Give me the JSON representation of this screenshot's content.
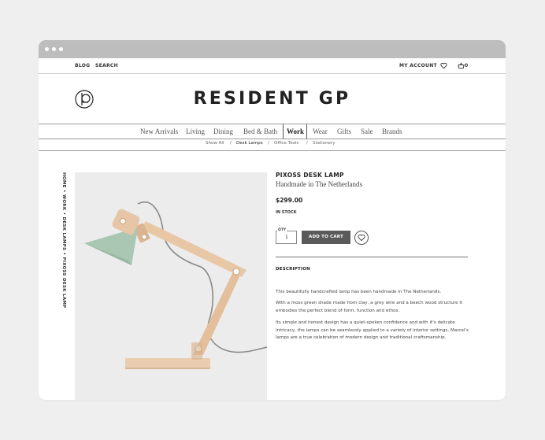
{
  "topbar": {
    "blog": "BLOG",
    "search": "SEARCH",
    "account": "MY ACCOUNT",
    "cart_count": "0"
  },
  "brand": {
    "name": "RESIDENT GP"
  },
  "nav": {
    "items": [
      "New Arrivals",
      "Living",
      "Dining",
      "Bed & Bath",
      "Work",
      "Wear",
      "Gifts",
      "Sale",
      "Brands"
    ],
    "active": "Work"
  },
  "subnav": {
    "items": [
      "Show All",
      "Desk Lamps",
      "Office Tools",
      "Stationery"
    ],
    "separators": [
      "/",
      "/",
      "/"
    ],
    "active": "Desk Lamps"
  },
  "breadcrumb": "HOME • WORK • DESK LAMPS • PIXOSS DESK LAMP",
  "product": {
    "title": "PIXOSS DESK LAMP",
    "subtitle": "Handmade in The Netherlands",
    "price": "$299.00",
    "stock": "IN STOCK",
    "qty_label": "QTY",
    "qty_value": "1",
    "add_to_cart": "ADD TO CART",
    "description_heading": "DESCRIPTION",
    "description": [
      "This beautifully handcrafted lamp has been handmade in The Netherlands.",
      "With a moss green shade made from clay, a grey wire and a beech wood structure it embodies the perfect blend of form, function and ethos.",
      "Its simple and honest design has a quiet-spoken confidence and with it's delicate intricacy, the lamps can be seamlessly applied to a variety of interior settings. Marcel's lamps are a true celebration of modern design and traditional craftsmanship."
    ]
  },
  "icons": {
    "heart": "heart-icon",
    "cart": "basket-icon",
    "wishlist": "heart-outline-icon",
    "logo": "resident-gp-monogram"
  },
  "colors": {
    "window_bar": "#bdbdbd",
    "add_to_cart_bg": "#5a5a5a",
    "lamp_shade": "#a9c7b2",
    "lamp_wood": "#e6c6a6"
  }
}
